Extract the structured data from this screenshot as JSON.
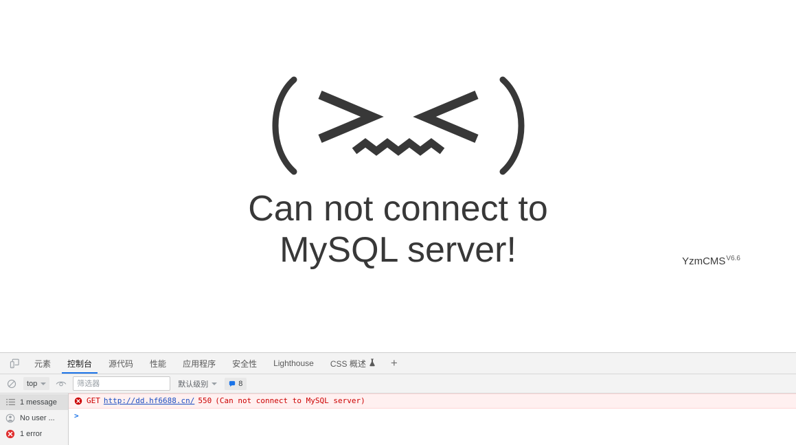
{
  "page": {
    "kaomoji": "(>﹏<)",
    "kaomoji_icon_name": "crying-face-kaomoji",
    "error_title": "Can not connect to MySQL server!",
    "cms_name": "YzmCMS",
    "cms_version": "V6.6",
    "text_color": "#383838",
    "background": "#ffffff"
  },
  "devtools": {
    "device_toggle_icon": "device-toolbar-icon",
    "tabs": [
      {
        "label": "元素",
        "name": "tab-elements",
        "active": false
      },
      {
        "label": "控制台",
        "name": "tab-console",
        "active": true
      },
      {
        "label": "源代码",
        "name": "tab-sources",
        "active": false
      },
      {
        "label": "性能",
        "name": "tab-performance",
        "active": false
      },
      {
        "label": "应用程序",
        "name": "tab-application",
        "active": false
      },
      {
        "label": "安全性",
        "name": "tab-security",
        "active": false
      },
      {
        "label": "Lighthouse",
        "name": "tab-lighthouse",
        "active": false
      },
      {
        "label": "CSS 概述",
        "name": "tab-css-overview",
        "active": false,
        "experimental": true
      }
    ],
    "add_tab_label": "+",
    "active_tab_accent": "#1a73e8",
    "console_toolbar": {
      "clear_icon": "clear-console-icon",
      "context_selector": "top",
      "live_expression_icon": "eye-icon",
      "filter_placeholder": "筛选器",
      "filter_value": "",
      "level_selector": "默认级别",
      "issues_count": "8",
      "issues_icon": "issues-bubble-icon",
      "issues_color": "#1a73e8"
    },
    "sidebar": [
      {
        "label": "1 message",
        "name": "sidebar-item-messages",
        "icon": "list-icon",
        "selected": true
      },
      {
        "label": "No user ...",
        "name": "sidebar-item-user-messages",
        "icon": "user-icon",
        "selected": false
      },
      {
        "label": "1 error",
        "name": "sidebar-item-errors",
        "icon": "error-circle-icon",
        "selected": false
      }
    ],
    "messages": [
      {
        "name": "console-error-row",
        "icon": "error-circle-icon",
        "method": "GET",
        "url": "http://dd.hf6688.cn/",
        "status": "550",
        "detail": "(Can not connect to MySQL server)",
        "color": "#cc0000",
        "background": "#fff0f0"
      }
    ],
    "prompt": {
      "chevron": ">",
      "value": ""
    }
  }
}
